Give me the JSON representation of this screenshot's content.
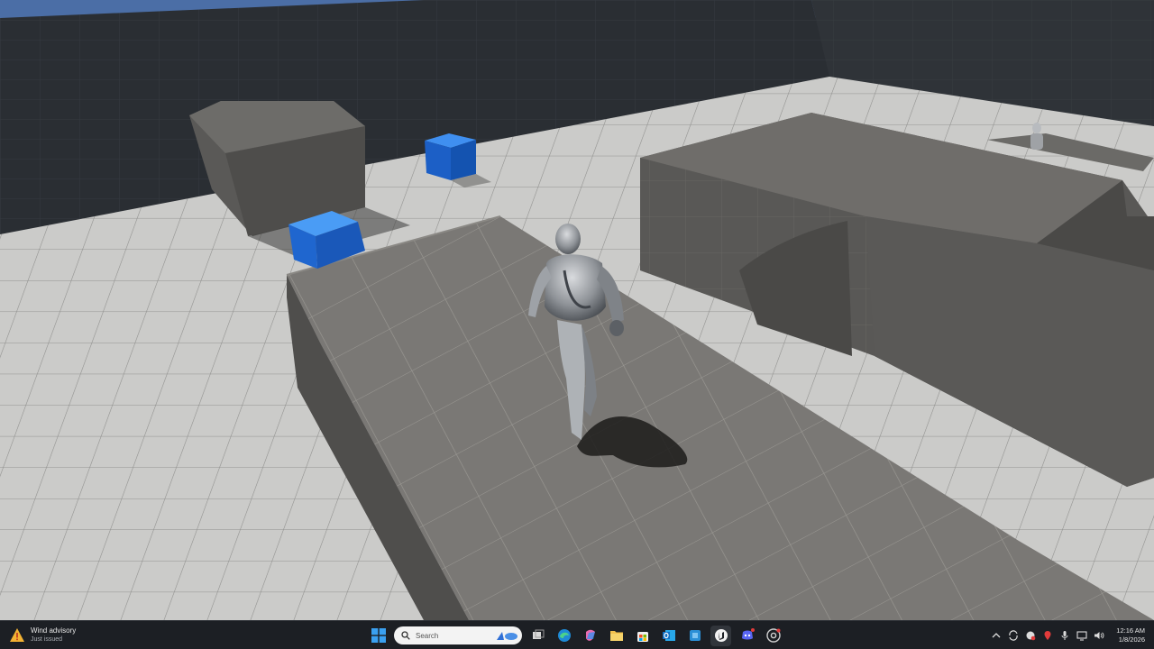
{
  "taskbar": {
    "widget": {
      "title": "Wind advisory",
      "subtitle": "Just issued",
      "icon": "warning-icon"
    },
    "search": {
      "placeholder": "Search",
      "icon": "search-icon"
    },
    "pinned_apps": [
      {
        "name": "task-view",
        "icon": "task-view-icon"
      },
      {
        "name": "edge",
        "icon": "edge-icon",
        "color": "#1e8ad6"
      },
      {
        "name": "copilot",
        "icon": "copilot-icon"
      },
      {
        "name": "file-explorer",
        "icon": "folder-icon",
        "color": "#f2c14e"
      },
      {
        "name": "microsoft-store",
        "icon": "store-icon"
      },
      {
        "name": "outlook",
        "icon": "outlook-icon",
        "color": "#1170c4"
      },
      {
        "name": "app-blue",
        "icon": "blue-app-icon",
        "color": "#2b8fd6"
      },
      {
        "name": "unreal-engine",
        "icon": "unreal-icon"
      },
      {
        "name": "discord",
        "icon": "discord-icon",
        "color": "#5865f2"
      },
      {
        "name": "chrome",
        "icon": "chrome-icon"
      }
    ],
    "clock": {
      "time": "12:16 AM",
      "date": "1/8/2026"
    }
  },
  "scene": {
    "description_icons": [
      "character",
      "blue-cube",
      "blue-cube",
      "platform"
    ],
    "colors": {
      "floor": "#c9c9c7",
      "platform_top": "#7b7976",
      "platform_side": "#555452",
      "wall": "#2a2f35",
      "cube": "#1e6fdc"
    }
  }
}
